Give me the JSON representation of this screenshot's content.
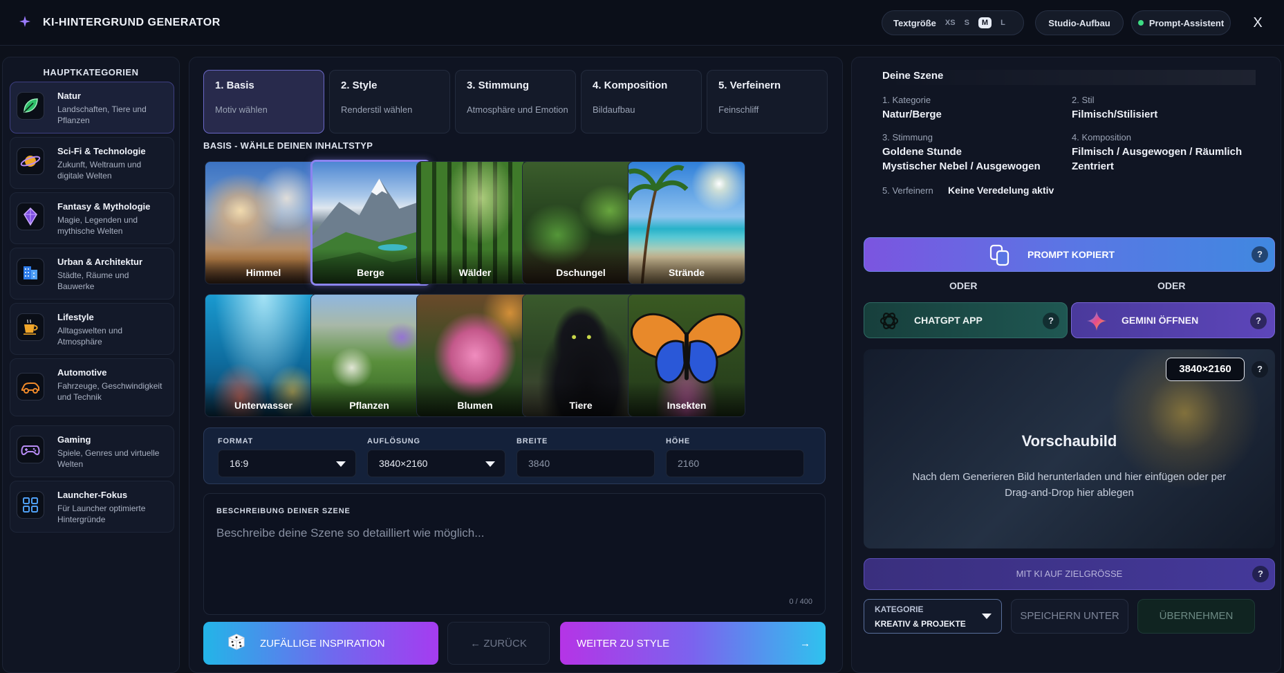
{
  "app": {
    "title": "KI-HINTERGRUND GENERATOR",
    "close_label": "X"
  },
  "topbar": {
    "text_size_label": "Textgröße",
    "text_sizes": [
      "XS",
      "S",
      "M",
      "L"
    ],
    "text_size_selected": "M",
    "studio_label": "Studio-Aufbau",
    "assistant_label": "Prompt-Assistent",
    "assistant_status_color": "#3ddc84"
  },
  "sidebar": {
    "title": "HAUPTKATEGORIEN",
    "items": [
      {
        "name": "Natur",
        "desc": "Landschaften, Tiere und Pflanzen",
        "icon": "leaf-icon",
        "active": true
      },
      {
        "name": "Sci-Fi & Technologie",
        "desc": "Zukunft, Weltraum und digitale Welten",
        "icon": "planet-icon"
      },
      {
        "name": "Fantasy & Mythologie",
        "desc": "Magie, Legenden und mythische Welten",
        "icon": "crystal-icon"
      },
      {
        "name": "Urban & Architektur",
        "desc": "Städte, Räume und Bauwerke",
        "icon": "building-icon"
      },
      {
        "name": "Lifestyle",
        "desc": "Alltagswelten und Atmosphäre",
        "icon": "coffee-cup-icon"
      },
      {
        "name": "Automotive",
        "desc": "Fahrzeuge, Geschwindigkeit und Technik",
        "icon": "car-icon"
      },
      {
        "name": "Gaming",
        "desc": "Spiele, Genres und virtuelle Welten",
        "icon": "gamepad-icon"
      },
      {
        "name": "Launcher-Fokus",
        "desc": "Für Launcher optimierte Hintergründe",
        "icon": "grid-icon"
      }
    ]
  },
  "steps": [
    {
      "title": "1. Basis",
      "sub": "Motiv wählen",
      "active": true
    },
    {
      "title": "2. Style",
      "sub": "Renderstil wählen"
    },
    {
      "title": "3. Stimmung",
      "sub": "Atmosphäre und Emotion"
    },
    {
      "title": "4. Komposition",
      "sub": "Bildaufbau"
    },
    {
      "title": "5. Verfeinern",
      "sub": "Feinschliff"
    }
  ],
  "basis": {
    "heading": "BASIS - WÄHLE DEINEN INHALTSTYP",
    "motifs": [
      "Himmel",
      "Berge",
      "Wälder",
      "Dschungel",
      "Strände",
      "Unterwasser",
      "Pflanzen",
      "Blumen",
      "Tiere",
      "Insekten"
    ],
    "selected": "Berge"
  },
  "format": {
    "format_label": "FORMAT",
    "format_value": "16:9",
    "resolution_label": "AUFLÖSUNG",
    "resolution_value": "3840×2160",
    "width_label": "BREITE",
    "width_value": "3840",
    "height_label": "HÖHE",
    "height_value": "2160"
  },
  "description": {
    "title": "BESCHREIBUNG DEINER SZENE",
    "placeholder": "Beschreibe deine Szene so detailliert wie möglich...",
    "counter": "0 / 400"
  },
  "actions": {
    "inspire_label": "ZUFÄLLIGE INSPIRATION",
    "back_label": "← ZURÜCK",
    "next_label": "WEITER ZU STYLE",
    "next_arrow": "→"
  },
  "scene": {
    "title": "Deine Szene",
    "category_label": "1. Kategorie",
    "category_value": "Natur/Berge",
    "style_label": "2. Stil",
    "style_value": "Filmisch/Stilisiert",
    "mood_label": "3. Stimmung",
    "mood_value_1": "Goldene Stunde",
    "mood_value_2": "Mystischer Nebel / Ausgewogen",
    "composition_label": "4. Komposition",
    "composition_value_1": "Filmisch / Ausgewogen / Räumlich",
    "composition_value_2": "Zentriert",
    "refine_label": "5. Verfeinern",
    "refine_value": "Keine Veredelung aktiv"
  },
  "assistant": {
    "prompt_label": "PROMPT KOPIERT",
    "help": "?",
    "or_left": "ODER",
    "or_right": "ODER",
    "chatgpt_label": "CHATGPT APP",
    "gemini_label": "GEMINI ÖFFNEN",
    "resolution_badge": "3840×2160",
    "preview_title": "Vorschaubild",
    "preview_text": "Nach dem Generieren Bild herunterladen und hier einfügen oder per Drag-and-Drop hier ablegen",
    "upscale_label": "MIT KI AUF ZIELGRÖSSE",
    "category_select_label": "KATEGORIE",
    "category_select_value": "KREATIV & PROJEKTE",
    "save_label": "SPEICHERN UNTER",
    "apply_label": "ÜBERNEHMEN"
  },
  "colors": {
    "accent_purple": "#8c84f0",
    "chatgpt_teal": "#1f5752",
    "gemini_purple": "#5d46ba"
  }
}
